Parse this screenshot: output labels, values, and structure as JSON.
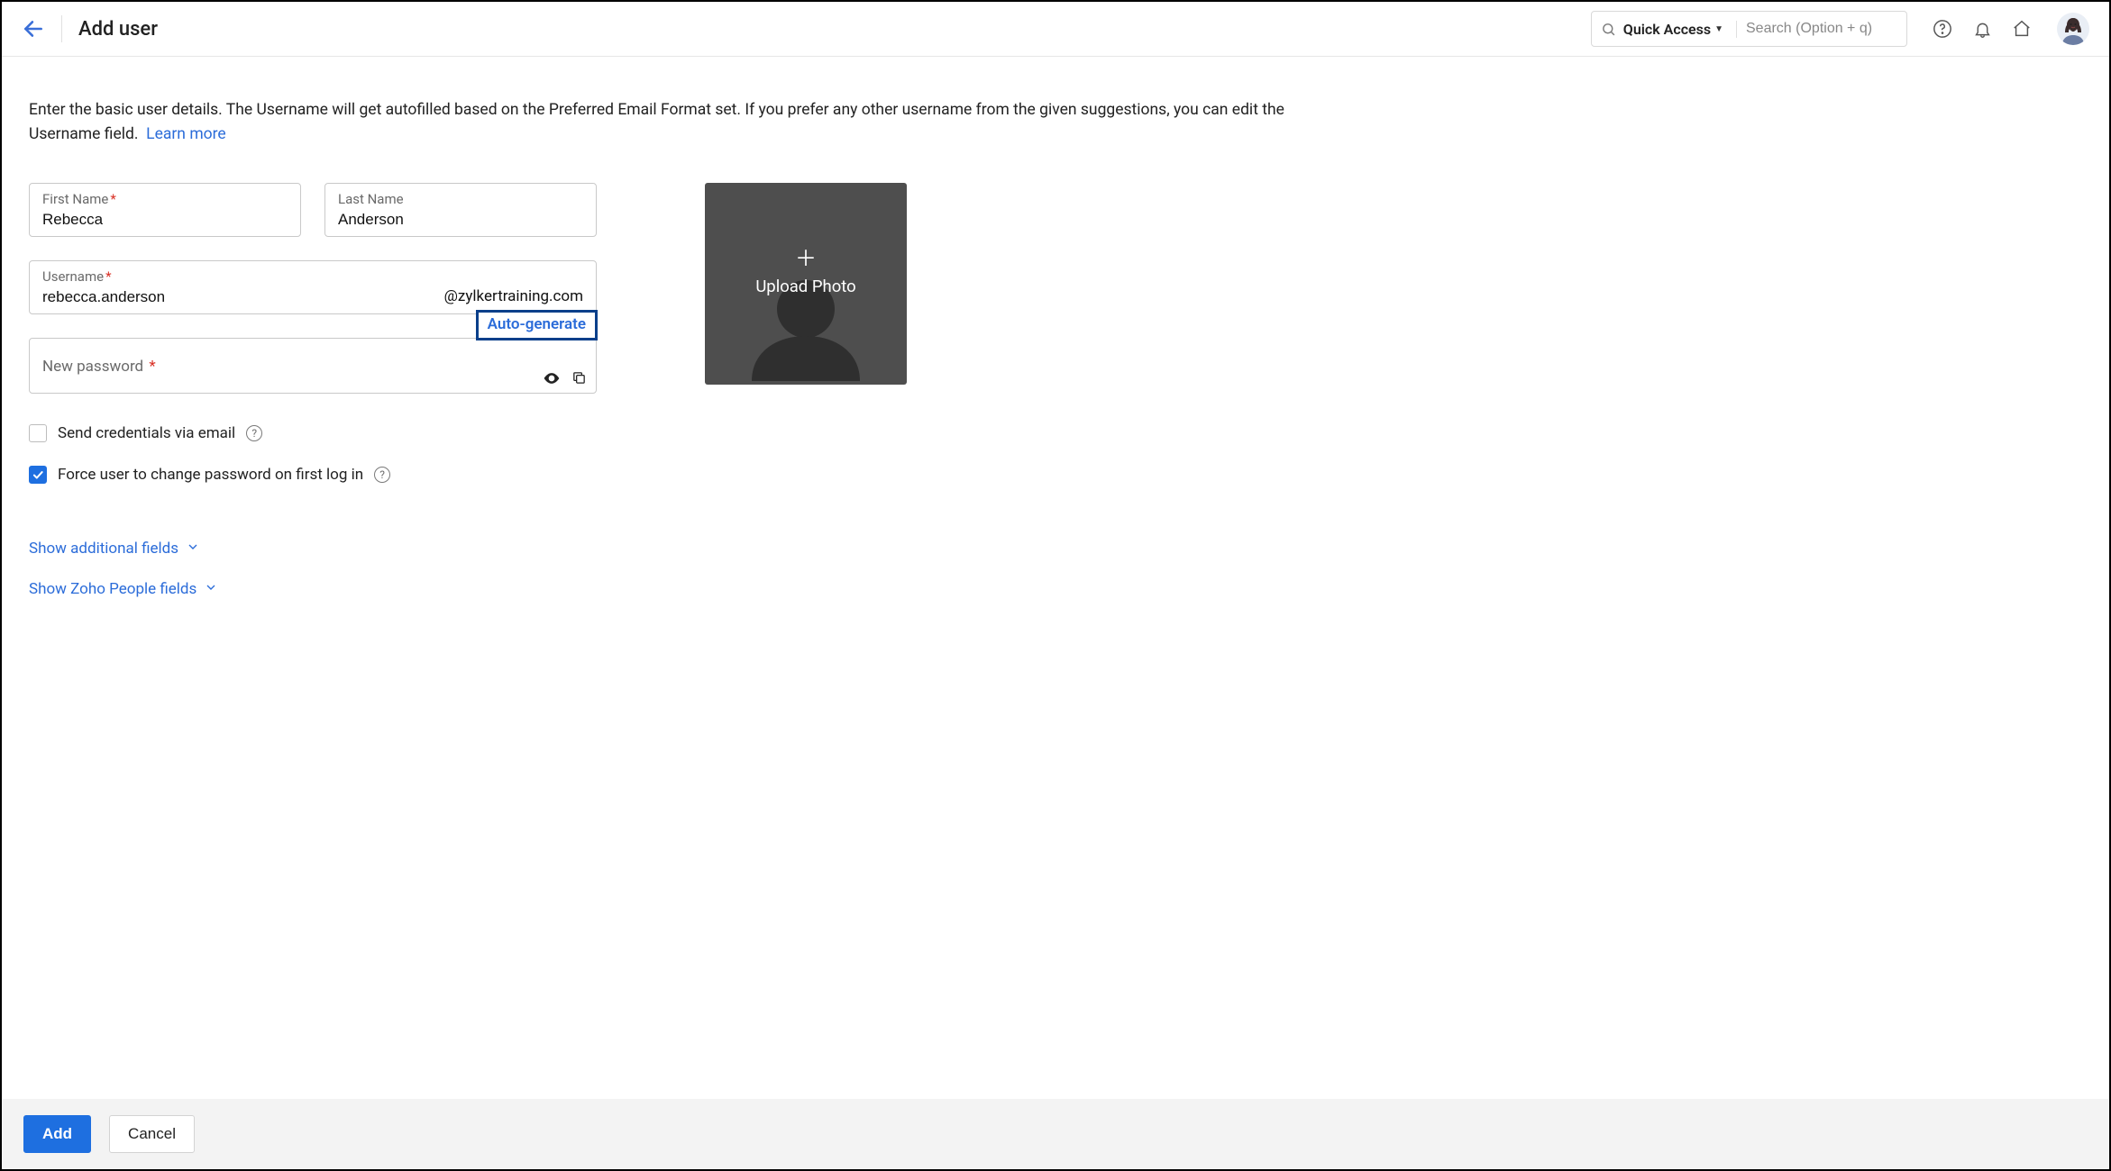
{
  "header": {
    "title": "Add user",
    "quick_access": "Quick Access",
    "search_placeholder": "Search (Option + q)"
  },
  "intro": {
    "text": "Enter the basic user details. The Username will get autofilled based on the Preferred Email Format set. If you prefer any other username from the given suggestions, you can edit the Username field.",
    "learn_more": "Learn more"
  },
  "fields": {
    "first_name": {
      "label": "First Name",
      "value": "Rebecca"
    },
    "last_name": {
      "label": "Last Name",
      "value": "Anderson"
    },
    "username": {
      "label": "Username",
      "value": "rebecca.anderson",
      "domain": "@zylkertraining.com"
    },
    "password": {
      "label": "New password",
      "auto_generate": "Auto-generate"
    }
  },
  "checks": {
    "send_credentials": "Send credentials via email",
    "force_change": "Force user to change password on first log in"
  },
  "links": {
    "additional": "Show additional fields",
    "people": "Show Zoho People fields"
  },
  "upload": {
    "label": "Upload Photo"
  },
  "footer": {
    "add": "Add",
    "cancel": "Cancel"
  }
}
